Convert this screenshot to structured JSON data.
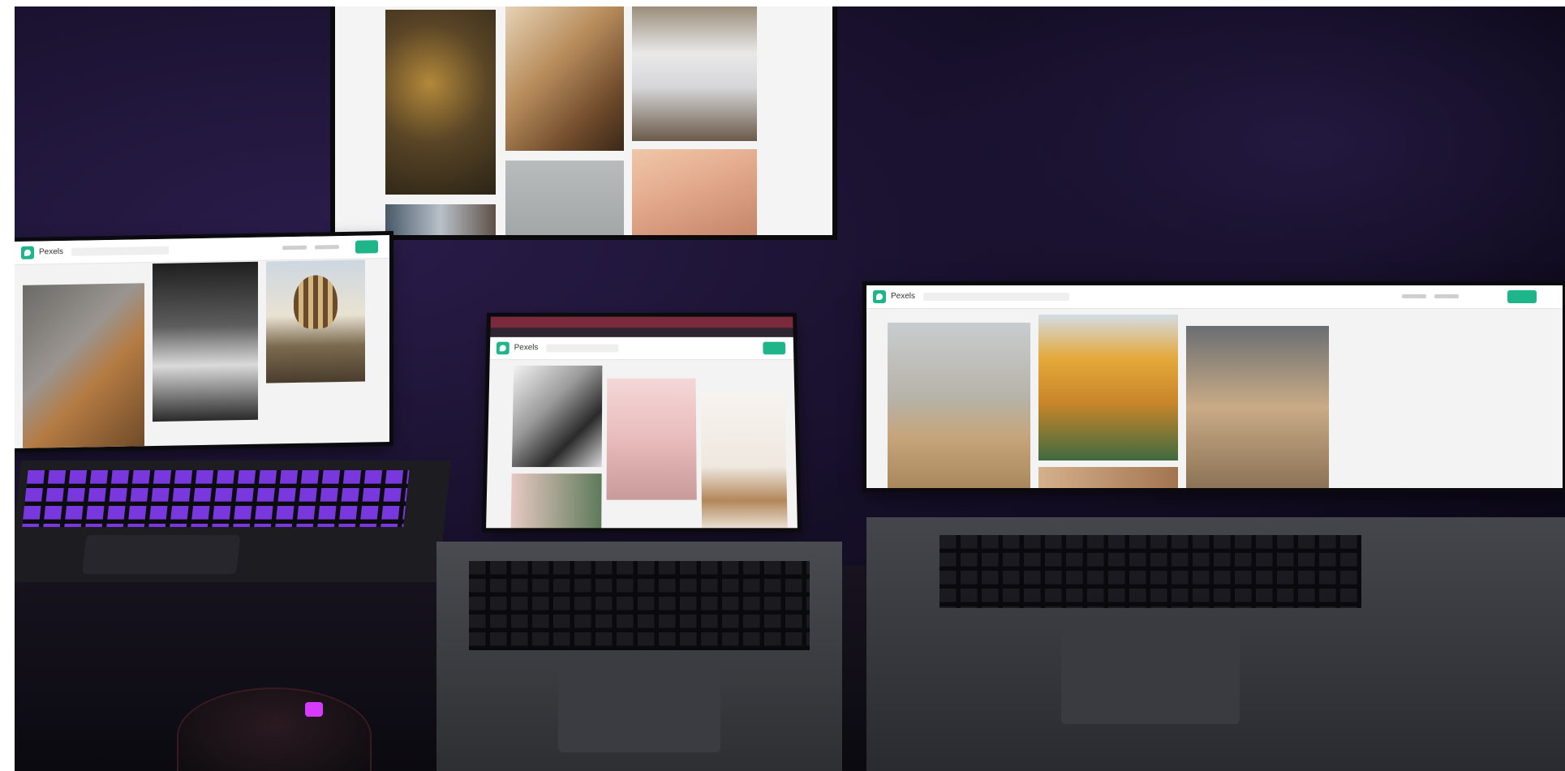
{
  "scene": {
    "description_colors": {
      "wall": "#160f29",
      "keyboard_backlight": "#8a3cff",
      "accent_green": "#1fb58a"
    }
  },
  "left_laptop": {
    "app_title": "Pexels"
  },
  "center_laptop": {
    "app_title": "Pexels"
  },
  "right_laptop": {
    "app_title": "Pexels"
  }
}
